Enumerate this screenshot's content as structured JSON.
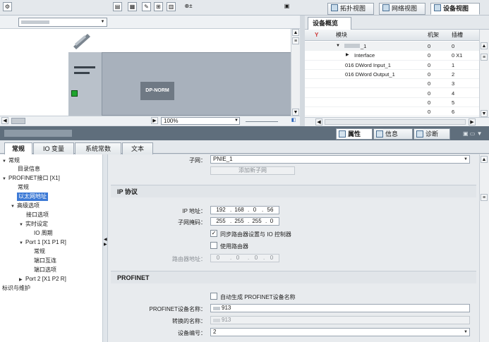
{
  "view_tabs": [
    {
      "label": "拓扑视图"
    },
    {
      "label": "网络视图"
    },
    {
      "label": "设备视图"
    }
  ],
  "device_view": {
    "module_label": "DP-NORM",
    "zoom": "100%"
  },
  "overview": {
    "tab": "设备概览",
    "columns": {
      "module": "模块",
      "rack": "机架",
      "slot": "插槽"
    },
    "rows": [
      {
        "module": "_1",
        "rack": "0",
        "slot": "0"
      },
      {
        "module": "Interface",
        "rack": "0",
        "slot": "0 X1"
      },
      {
        "module": "016 DWord Input_1",
        "rack": "0",
        "slot": "1"
      },
      {
        "module": "016 DWord Output_1",
        "rack": "0",
        "slot": "2"
      },
      {
        "module": "",
        "rack": "0",
        "slot": "3"
      },
      {
        "module": "",
        "rack": "0",
        "slot": "4"
      },
      {
        "module": "",
        "rack": "0",
        "slot": "5"
      },
      {
        "module": "",
        "rack": "0",
        "slot": "6"
      }
    ]
  },
  "inspector": {
    "tabs": [
      {
        "label": "属性"
      },
      {
        "label": "信息"
      },
      {
        "label": "诊断"
      }
    ]
  },
  "subtabs": [
    "常规",
    "IO 变量",
    "系统常数",
    "文本"
  ],
  "tree": [
    {
      "label": "常规",
      "arrow": "▼"
    },
    {
      "label": "目录信息",
      "arrow": ""
    },
    {
      "label": "PROFINET接口 [X1]",
      "arrow": "▼"
    },
    {
      "label": "常规",
      "arrow": ""
    },
    {
      "label": "以太网地址",
      "arrow": ""
    },
    {
      "label": "高级选项",
      "arrow": "▼"
    },
    {
      "label": "接口选项",
      "arrow": ""
    },
    {
      "label": "实时设定",
      "arrow": "▼"
    },
    {
      "label": "IO 周期",
      "arrow": ""
    },
    {
      "label": "Port 1 [X1 P1 R]",
      "arrow": "▼"
    },
    {
      "label": "常规",
      "arrow": ""
    },
    {
      "label": "端口互连",
      "arrow": ""
    },
    {
      "label": "端口选项",
      "arrow": ""
    },
    {
      "label": "Port 2 [X1 P2 R]",
      "arrow": "▶"
    },
    {
      "label": "标识与维护",
      "arrow": ""
    }
  ],
  "props": {
    "subnet_label": "子网：",
    "subnet_value": "PNIE_1",
    "add_subnet": "添加新子网",
    "ip_section": "IP 协议",
    "ip_label": "IP 地址：",
    "ip": [
      "192",
      "168",
      "0",
      "56"
    ],
    "mask_label": "子网掩码：",
    "mask": [
      "255",
      "255",
      "255",
      "0"
    ],
    "sync_router": "同步路由器设置与 IO 控制器",
    "sync_router_checked": true,
    "use_router": "使用路由器",
    "use_router_checked": false,
    "router_label": "路由器地址：",
    "router": [
      "0",
      "0",
      "0",
      "0"
    ],
    "profinet_section": "PROFINET",
    "auto_name": "自动生成 PROFINET设备名称",
    "auto_name_checked": false,
    "device_name_label": "PROFINET设备名称：",
    "device_name": "913",
    "converted_label": "转换的名称：",
    "converted_name": "913",
    "device_number_label": "设备编号：",
    "device_number": "2"
  }
}
